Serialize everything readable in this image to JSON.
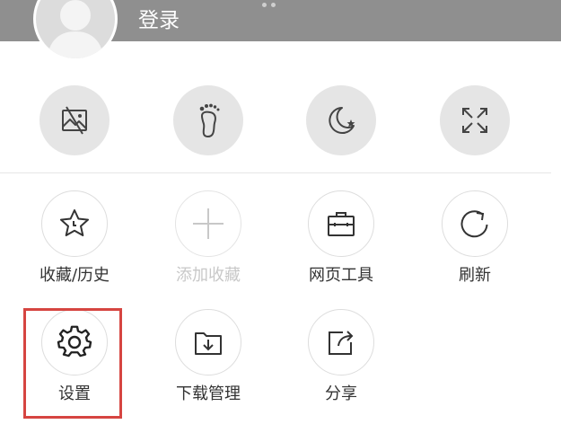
{
  "header": {
    "login_label": "登录",
    "avatar_icon": "user-avatar-icon",
    "page_dots": 2
  },
  "quick_actions": [
    {
      "icon": "no-image-icon"
    },
    {
      "icon": "footprint-icon"
    },
    {
      "icon": "night-mode-icon"
    },
    {
      "icon": "fullscreen-icon"
    }
  ],
  "menu": {
    "favorites_history": "收藏/历史",
    "add_favorite": "添加收藏",
    "web_tools": "网页工具",
    "refresh": "刷新",
    "settings": "设置",
    "download_manager": "下载管理",
    "share": "分享"
  },
  "colors": {
    "header_bg": "#8f8f8f",
    "highlight_border": "#d64541",
    "disabled_text": "#c8c8c8"
  }
}
